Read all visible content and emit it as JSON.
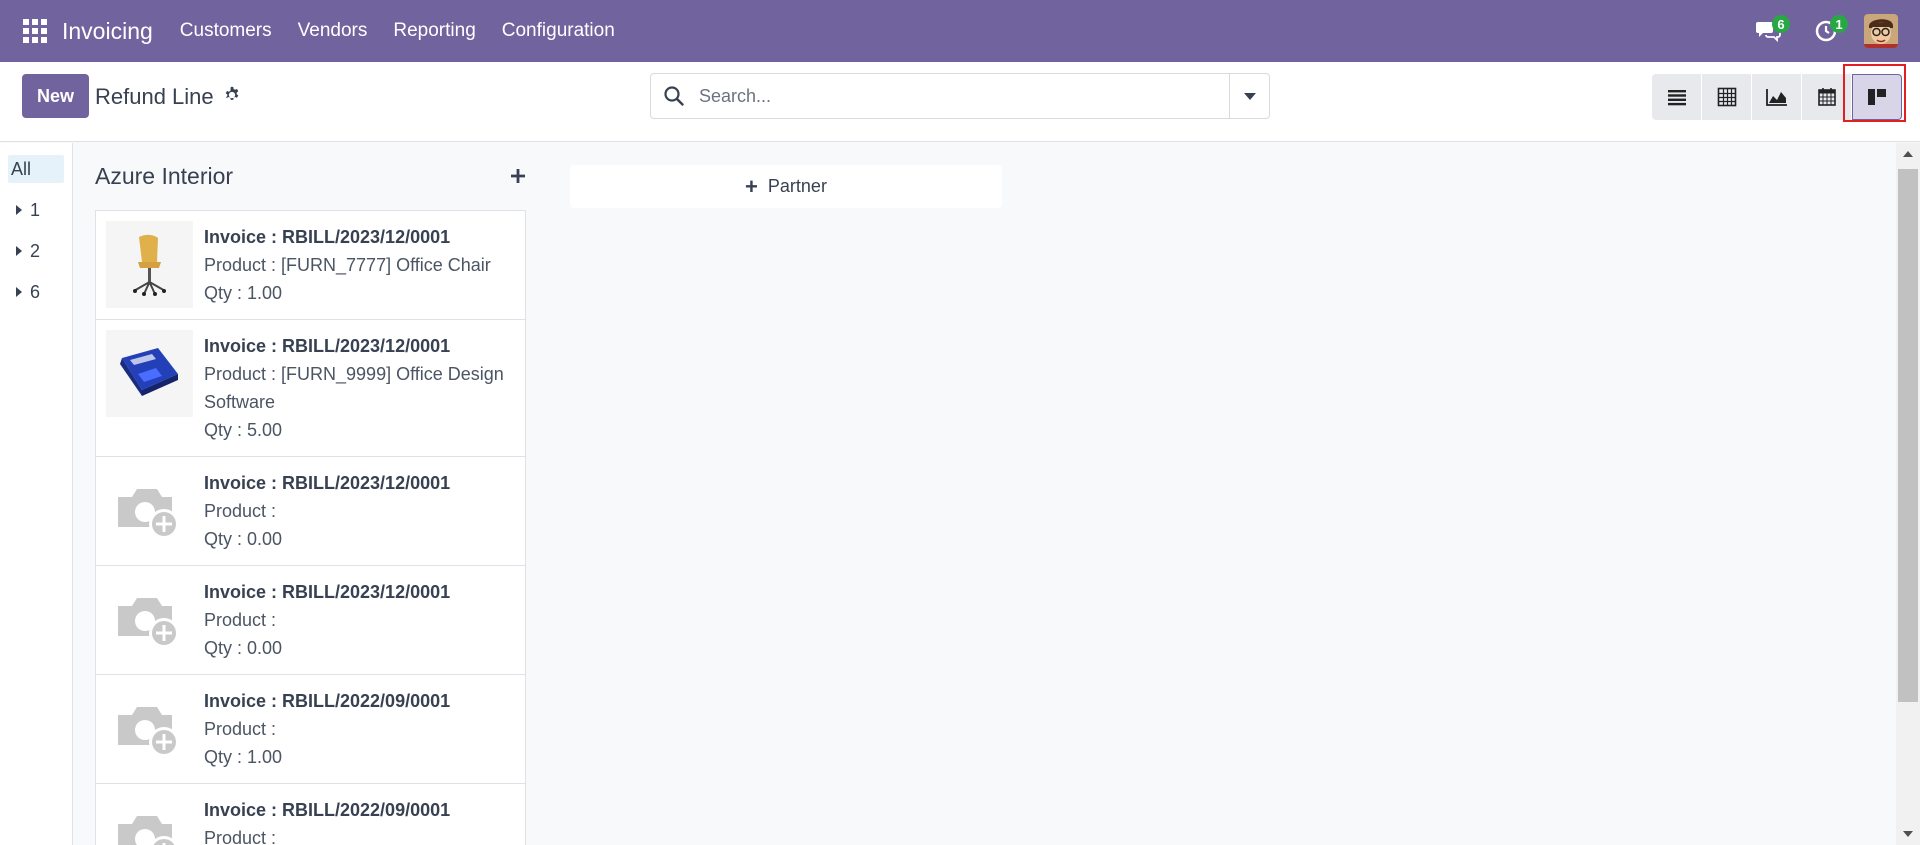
{
  "navbar": {
    "app_name": "Invoicing",
    "menu": [
      "Customers",
      "Vendors",
      "Reporting",
      "Configuration"
    ],
    "messages_count": "6",
    "activities_count": "1",
    "color": "#71639e"
  },
  "control": {
    "new_label": "New",
    "title": "Refund Line",
    "search_placeholder": "Search...",
    "views": [
      "list-view-icon",
      "pivot-view-icon",
      "graph-view-icon",
      "calendar-view-icon",
      "kanban-view-icon"
    ],
    "active_view": "kanban"
  },
  "sidebar": {
    "items": [
      "All",
      "1",
      "2",
      "6"
    ]
  },
  "column": {
    "title": "Azure Interior",
    "cards": [
      {
        "invoice": "Invoice : RBILL/2023/12/0001",
        "product": "Product : [FURN_7777] Office Chair",
        "qty": "Qty : 1.00",
        "image": "office-chair-image"
      },
      {
        "invoice": "Invoice : RBILL/2023/12/0001",
        "product": "Product : [FURN_9999] Office Design Software",
        "qty": "Qty : 5.00",
        "image": "software-box-image"
      },
      {
        "invoice": "Invoice : RBILL/2023/12/0001",
        "product": "Product :",
        "qty": "Qty : 0.00",
        "image": "camera-placeholder-icon"
      },
      {
        "invoice": "Invoice : RBILL/2023/12/0001",
        "product": "Product :",
        "qty": "Qty : 0.00",
        "image": "camera-placeholder-icon"
      },
      {
        "invoice": "Invoice : RBILL/2022/09/0001",
        "product": "Product :",
        "qty": "Qty : 1.00",
        "image": "camera-placeholder-icon"
      },
      {
        "invoice": "Invoice : RBILL/2022/09/0001",
        "product": "Product :",
        "qty": "",
        "image": "camera-placeholder-icon"
      }
    ]
  },
  "add_column_label": "Partner"
}
